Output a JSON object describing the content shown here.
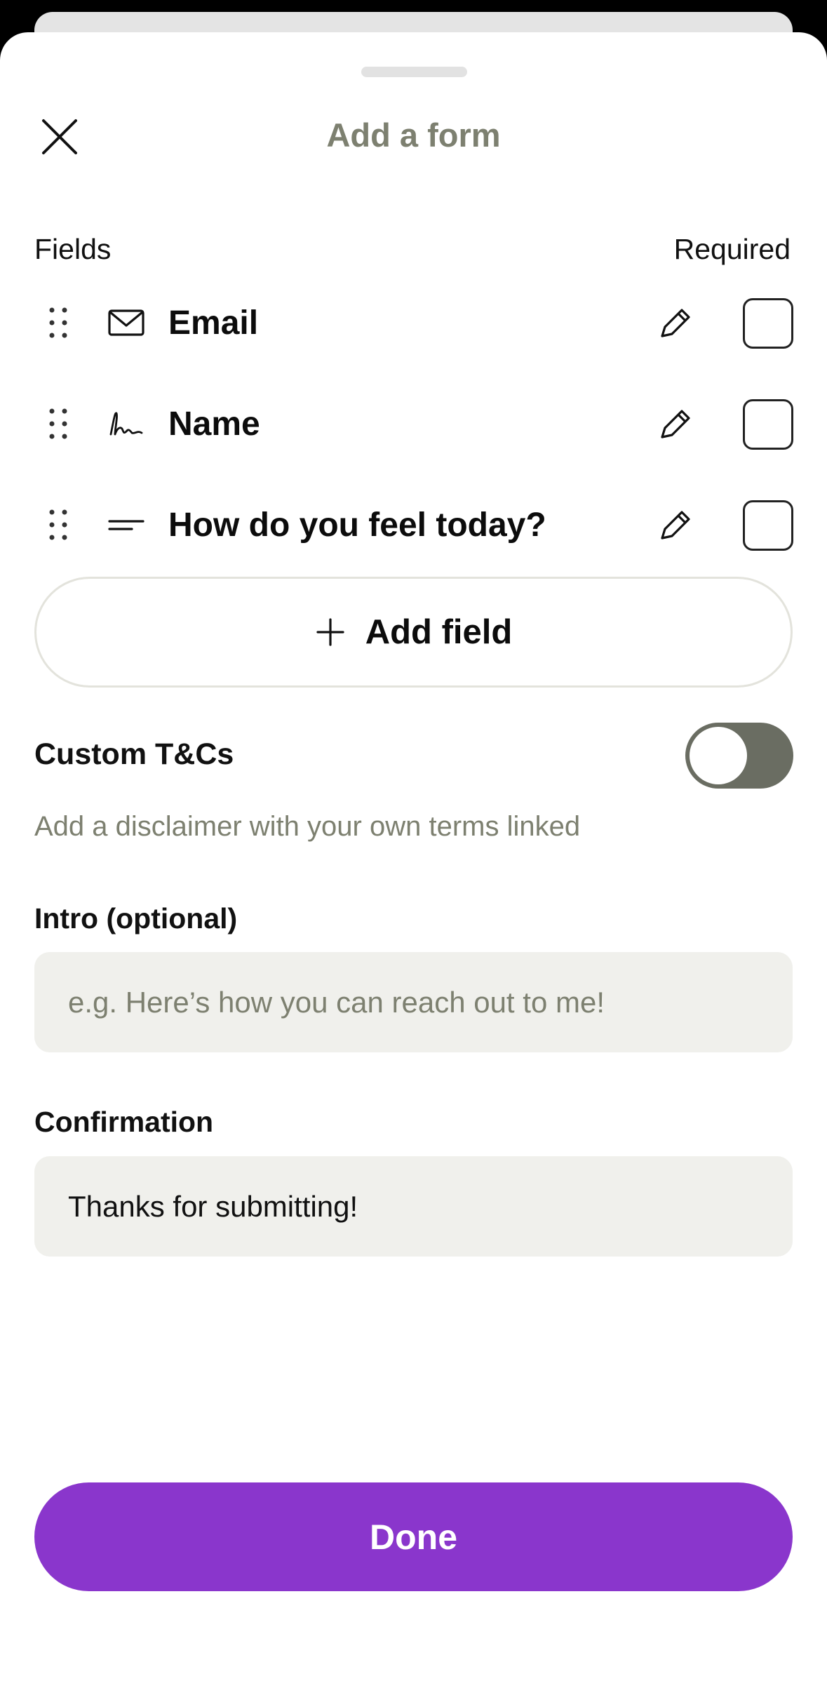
{
  "sheet": {
    "title": "Add a form"
  },
  "fields_section": {
    "header_fields": "Fields",
    "header_required": "Required",
    "rows": [
      {
        "label": "Email",
        "icon": "envelope-icon",
        "required": false
      },
      {
        "label": "Name",
        "icon": "signature-icon",
        "required": false
      },
      {
        "label": "How do you feel today?",
        "icon": "text-lines-icon",
        "required": false
      }
    ],
    "add_field_label": "Add field"
  },
  "custom_tcs": {
    "label": "Custom T&Cs",
    "description": "Add a disclaimer with your own terms linked",
    "enabled": false
  },
  "intro": {
    "label": "Intro (optional)",
    "placeholder": "e.g. Here’s how you can reach out to me!",
    "value": ""
  },
  "confirmation": {
    "label": "Confirmation",
    "value": "Thanks for submitting!"
  },
  "done_label": "Done",
  "colors": {
    "accent": "#8a36cc",
    "title_muted": "#7d8070",
    "toggle_track": "#6a6d62",
    "input_background": "#f0f0ec"
  }
}
